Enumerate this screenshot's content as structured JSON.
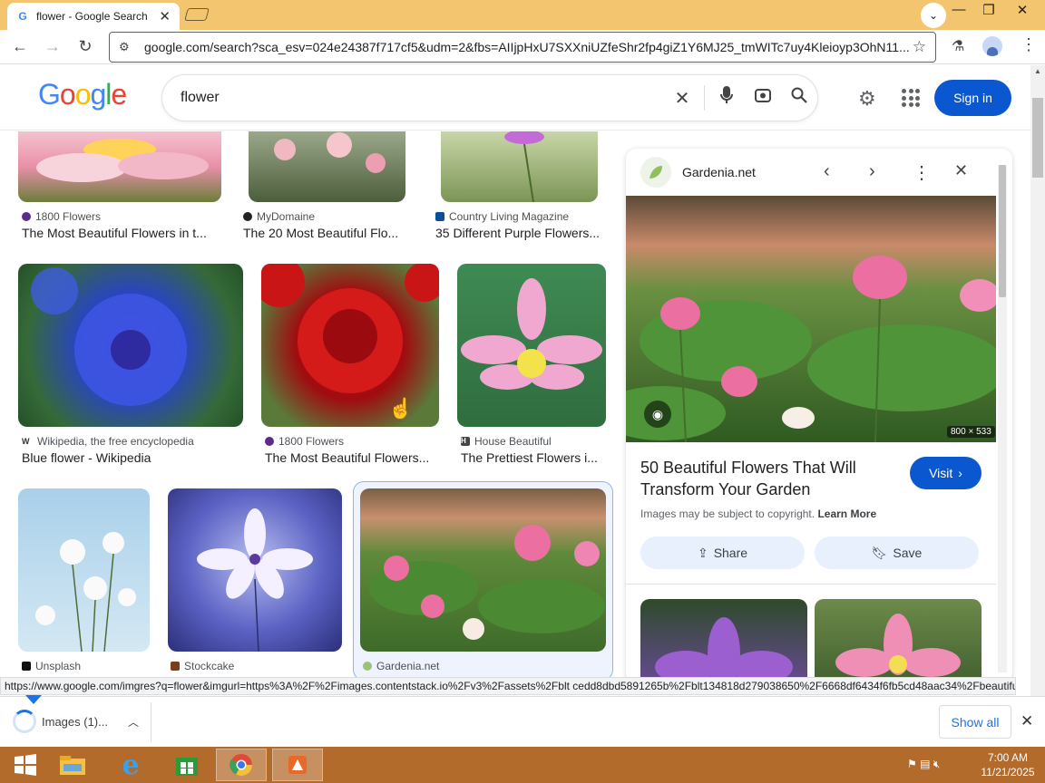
{
  "browser": {
    "tab_title": "flower - Google Search",
    "url": "google.com/search?sca_esv=024e24387f717cf5&udm=2&fbs=AIIjpHxU7SXXniUZfeShr2fp4giZ1Y6MJ25_tmWITc7uy4Kleioyp3OhN11...",
    "status_url": "https://www.google.com/imgres?q=flower&imgurl=https%3A%2F%2Fimages.contentstack.io%2Fv3%2Fassets%2Fblt cedd8dbd5891265b%2Fblt134818d279038650%2F6668df6434f6fb5cd48aac34%2Fbeautiful..."
  },
  "google": {
    "logo": "Google",
    "query": "flower",
    "signin_label": "Sign in"
  },
  "results": [
    {
      "source": "1800 Flowers",
      "title": "The Most Beautiful Flowers in t..."
    },
    {
      "source": "MyDomaine",
      "title": "The 20 Most Beautiful Flo..."
    },
    {
      "source": "Country Living Magazine",
      "title": "35 Different Purple Flowers..."
    },
    {
      "source": "Wikipedia, the free encyclopedia",
      "title": "Blue flower - Wikipedia"
    },
    {
      "source": "1800 Flowers",
      "title": "The Most Beautiful Flowers..."
    },
    {
      "source": "House Beautiful",
      "title": "The Prettiest Flowers i..."
    },
    {
      "source": "Unsplash",
      "title": ""
    },
    {
      "source": "Stockcake",
      "title": ""
    },
    {
      "source": "Gardenia.net",
      "title": ""
    }
  ],
  "panel": {
    "site": "Gardenia.net",
    "dimensions": "800 × 533",
    "title": "50 Beautiful Flowers That Will Transform Your Garden",
    "visit_label": "Visit",
    "copyright": "Images may be subject to copyright.",
    "learn_more": "Learn More",
    "share_label": "Share",
    "save_label": "Save"
  },
  "downloads": {
    "item_label": "Images (1)...",
    "show_all": "Show all"
  },
  "taskbar": {
    "time": "7:00 AM",
    "date": "11/21/2025"
  },
  "colors": {
    "accent": "#0b57d0",
    "titlebar": "#f3c56f",
    "taskbar": "#b36b2c"
  }
}
